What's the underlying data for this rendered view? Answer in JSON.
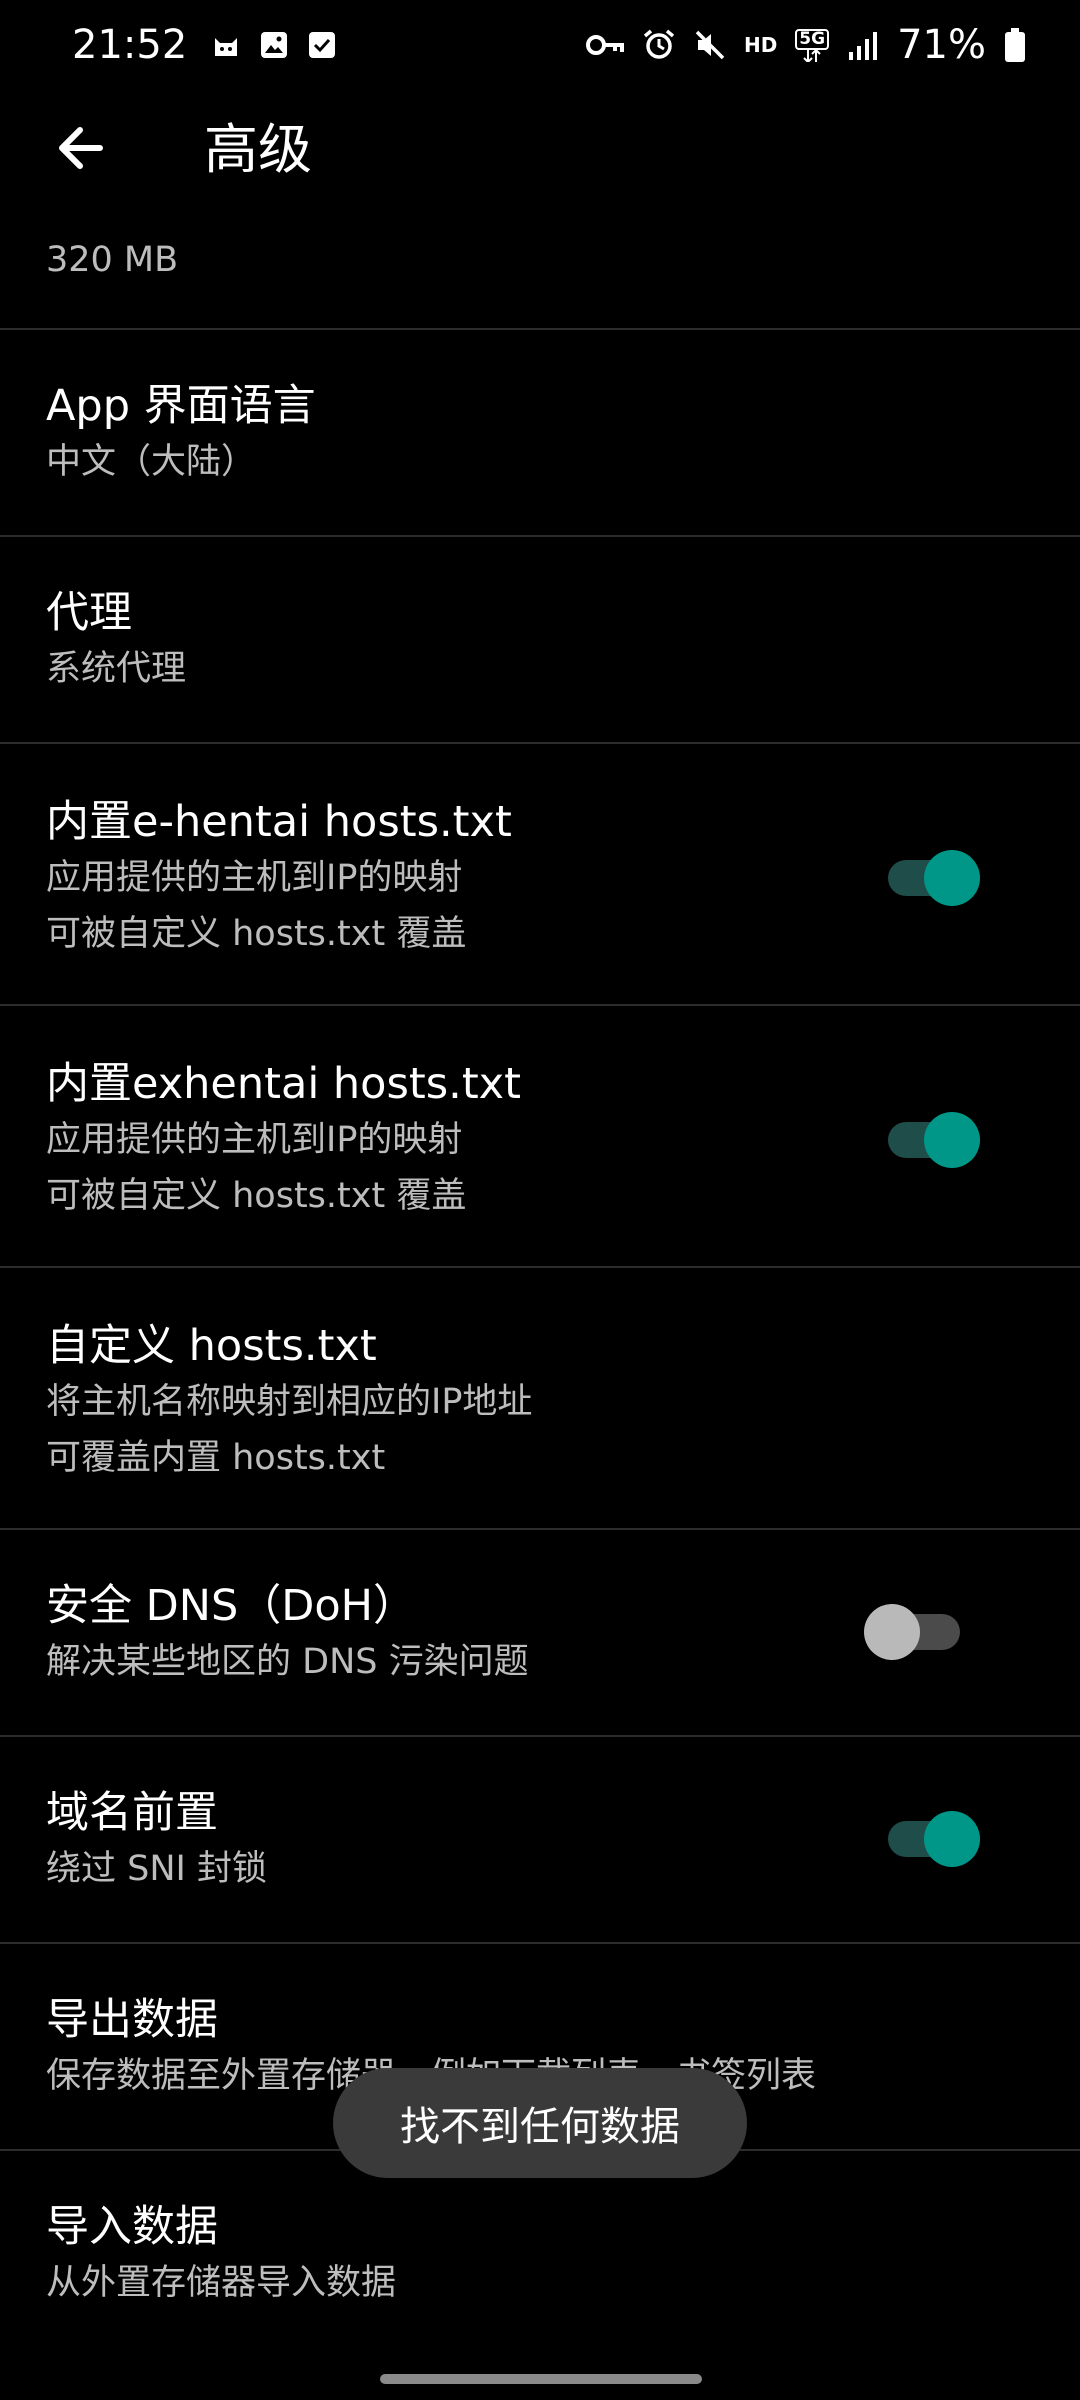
{
  "status_bar": {
    "time": "21:52",
    "hd_label": "HD",
    "network_label": "5G",
    "battery_percent": "71%"
  },
  "app_bar": {
    "title": "高级"
  },
  "list": {
    "partial_summary": "320 MB",
    "items": [
      {
        "title": "App 界面语言",
        "summary": "中文（大陆）"
      },
      {
        "title": "代理",
        "summary": "系统代理"
      },
      {
        "title": "内置e-hentai hosts.txt",
        "summary1": "应用提供的主机到IP的映射",
        "summary2": "可被自定义 hosts.txt 覆盖",
        "switch_on": true
      },
      {
        "title": "内置exhentai hosts.txt",
        "summary1": "应用提供的主机到IP的映射",
        "summary2": "可被自定义 hosts.txt 覆盖",
        "switch_on": true
      },
      {
        "title": "自定义 hosts.txt",
        "summary1": "将主机名称映射到相应的IP地址",
        "summary2": "可覆盖内置 hosts.txt"
      },
      {
        "title": "安全 DNS（DoH）",
        "summary": "解决某些地区的 DNS 污染问题",
        "switch_on": false
      },
      {
        "title": "域名前置",
        "summary": "绕过 SNI 封锁",
        "switch_on": true
      },
      {
        "title": "导出数据",
        "summary": "保存数据至外置存储器，例如下载列表，书签列表"
      },
      {
        "title": "导入数据",
        "summary": "从外置存储器导入数据"
      }
    ]
  },
  "toast": {
    "message": "找不到任何数据"
  },
  "colors": {
    "accent": "#009688",
    "background": "#000000",
    "divider": "#2c2c2c",
    "summary_text": "#bdbdbd"
  }
}
